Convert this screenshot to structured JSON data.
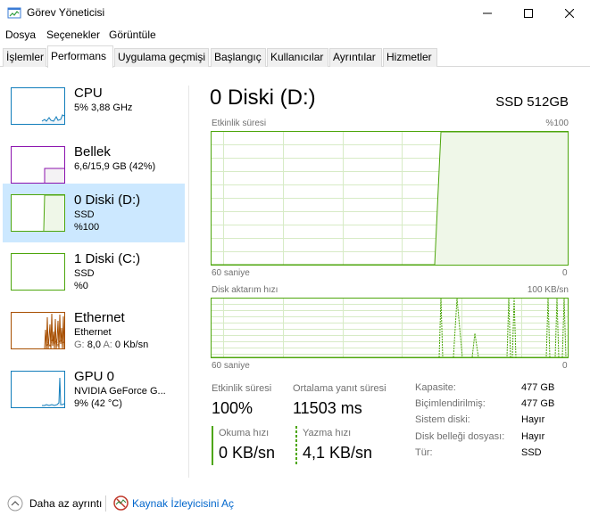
{
  "window": {
    "title": "Görev Yöneticisi"
  },
  "menu": [
    "Dosya",
    "Seçenekler",
    "Görüntüle"
  ],
  "tabs": [
    {
      "label": "İşlemler"
    },
    {
      "label": "Performans"
    },
    {
      "label": "Uygulama geçmişi"
    },
    {
      "label": "Başlangıç"
    },
    {
      "label": "Kullanıcılar"
    },
    {
      "label": "Ayrıntılar"
    },
    {
      "label": "Hizmetler"
    }
  ],
  "active_tab": "Performans",
  "resources": [
    {
      "name": "CPU",
      "line1": "5%  3,88 GHz",
      "line2": "",
      "color": "#117dbb",
      "selected": false
    },
    {
      "name": "Bellek",
      "line1": "6,6/15,9 GB (42%)",
      "line2": "",
      "color": "#8b12ae",
      "selected": false
    },
    {
      "name": "0 Diski (D:)",
      "line1": "SSD",
      "line2": "%100",
      "color": "#4da60c",
      "selected": true
    },
    {
      "name": "1 Diski (C:)",
      "line1": "SSD",
      "line2": "%0",
      "color": "#4da60c",
      "selected": false
    },
    {
      "name": "Ethernet",
      "line1": "Ethernet",
      "line2_parts": {
        "g_label": "G:",
        "g_value": "8,0",
        "a_label": "A:",
        "a_value": "0 Kb/sn"
      },
      "color": "#a74f01",
      "selected": false
    },
    {
      "name": "GPU 0",
      "line1": "NVIDIA GeForce G...",
      "line2": "9% (42 °C)",
      "color": "#117dbb",
      "selected": false
    }
  ],
  "detail": {
    "title": "0 Diski (D:)",
    "model": "SSD 512GB",
    "activity_graph": {
      "label": "Etkinlik süresi",
      "max_label": "%100",
      "time_label": "60 saniye",
      "min_label": "0"
    },
    "transfer_graph": {
      "label": "Disk aktarım hızı",
      "max_label": "100 KB/sn",
      "time_label": "60 saniye",
      "min_label": "0"
    },
    "stats": {
      "activity_label": "Etkinlik süresi",
      "activity_value": "100%",
      "response_label": "Ortalama yanıt süresi",
      "response_value": "11503 ms",
      "read_label": "Okuma hızı",
      "read_value": "0 KB/sn",
      "write_label": "Yazma hızı",
      "write_value": "4,1 KB/sn"
    },
    "properties": [
      {
        "key": "Kapasite:",
        "value": "477 GB"
      },
      {
        "key": "Biçimlendirilmiş:",
        "value": "477 GB"
      },
      {
        "key": "Sistem diski:",
        "value": "Hayır"
      },
      {
        "key": "Disk belleği dosyası:",
        "value": "Hayır"
      },
      {
        "key": "Tür:",
        "value": "SSD"
      }
    ]
  },
  "footer": {
    "fewer_details": "Daha az ayrıntı",
    "resource_monitor": "Kaynak İzleyicisini Aç"
  },
  "colors": {
    "disk": "#4da60c",
    "disk_fill": "#eff7e8",
    "grid": "#d7ebc6",
    "selection": "#cce8ff",
    "link": "#0066cc"
  }
}
